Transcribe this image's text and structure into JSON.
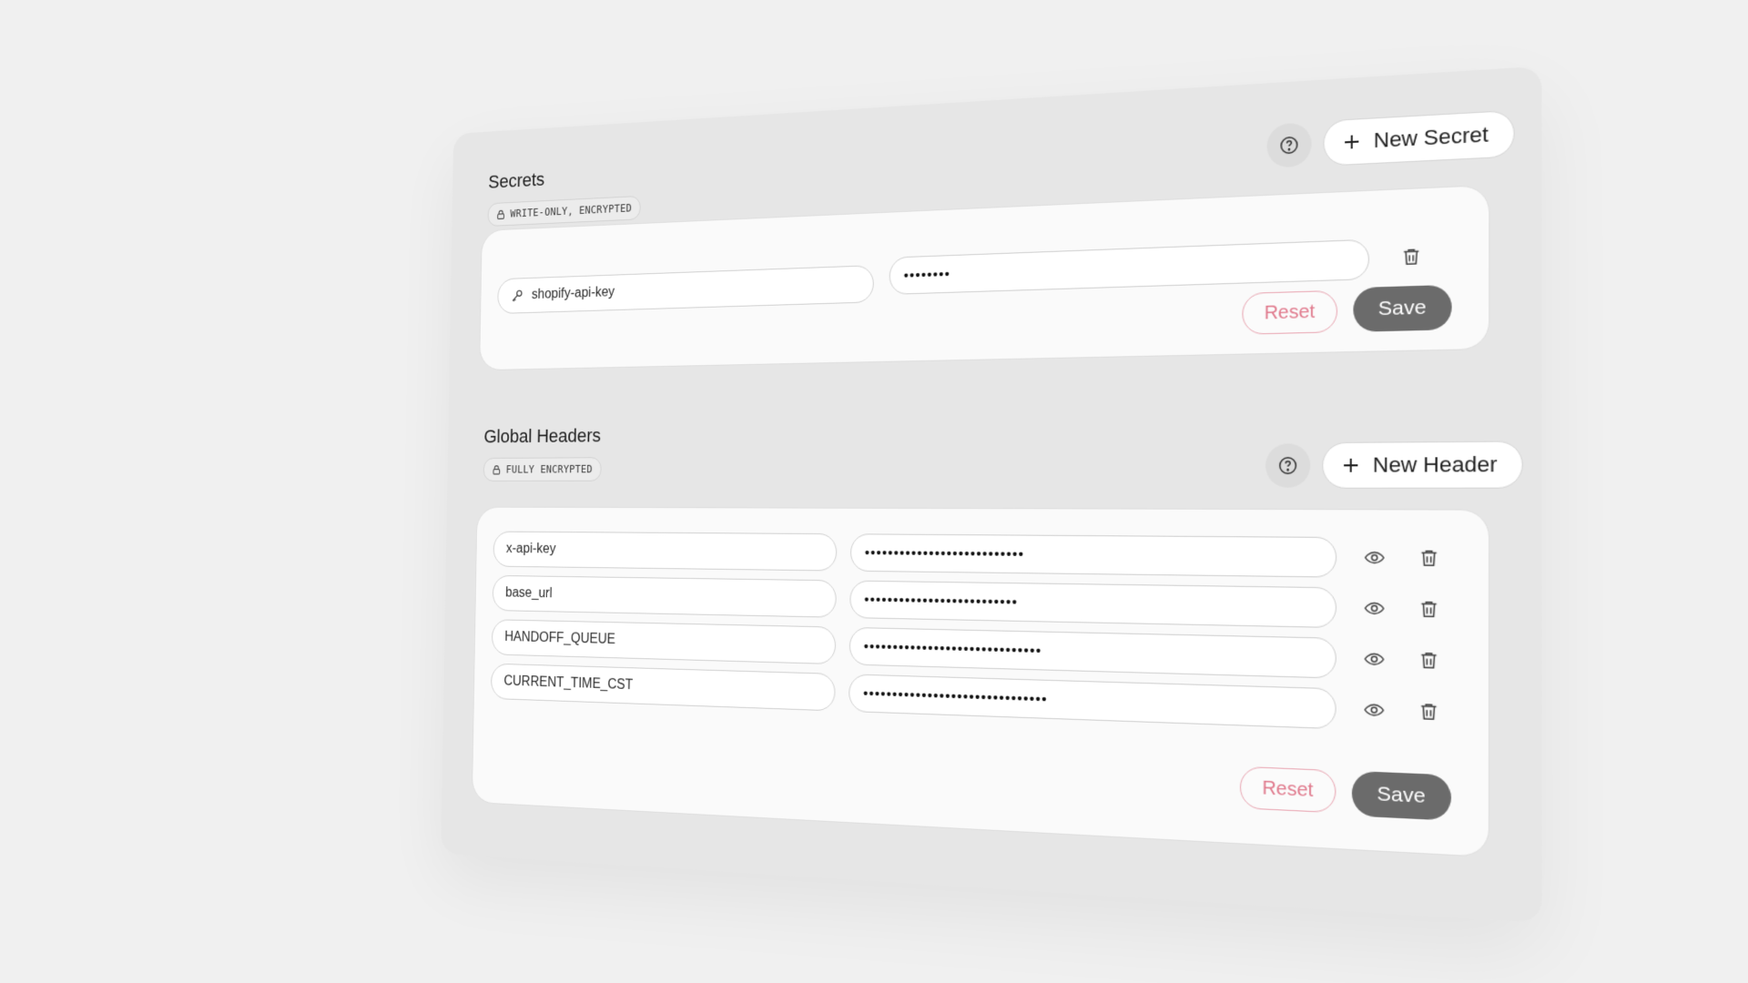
{
  "secrets": {
    "title": "Secrets",
    "badge": "WRITE-ONLY, ENCRYPTED",
    "new_button": "New Secret",
    "rows": [
      {
        "name": "shopify-api-key",
        "value": "••••••••"
      }
    ],
    "reset_label": "Reset",
    "save_label": "Save"
  },
  "headers": {
    "title": "Global Headers",
    "badge": "FULLY ENCRYPTED",
    "new_button": "New Header",
    "rows": [
      {
        "name": "x-api-key",
        "value": "•••••••••••••••••••••••••••"
      },
      {
        "name": "base_url",
        "value": "••••••••••••••••••••••••••"
      },
      {
        "name": "HANDOFF_QUEUE",
        "value": "••••••••••••••••••••••••••••••"
      },
      {
        "name": "CURRENT_TIME_CST",
        "value": "•••••••••••••••••••••••••••••••"
      }
    ],
    "reset_label": "Reset",
    "save_label": "Save"
  },
  "colors": {
    "reset": "#e07a8d",
    "save_bg": "#6b6b6b",
    "panel_bg": "#e6e6e6",
    "card_bg": "#fafafa"
  },
  "icons": {
    "help": "question-circle-icon",
    "add": "plus-icon",
    "lock": "lock-icon",
    "key": "key-icon",
    "reveal": "eye-icon",
    "delete": "trash-icon"
  }
}
